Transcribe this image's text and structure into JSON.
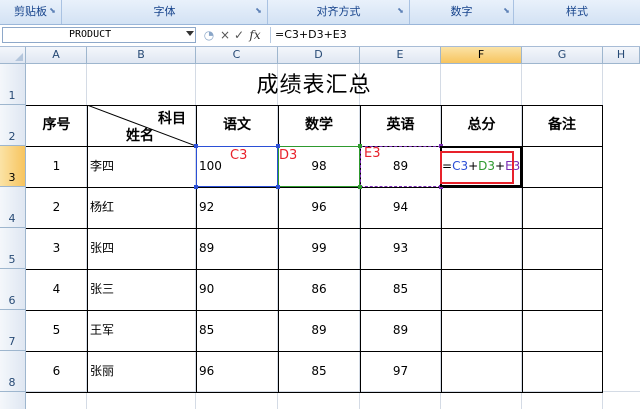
{
  "ribbon": {
    "groups": [
      {
        "label": "剪贴板"
      },
      {
        "label": "字体"
      },
      {
        "label": "对齐方式"
      },
      {
        "label": "数字"
      },
      {
        "label": "样式"
      }
    ]
  },
  "formula_bar": {
    "name_box": "PRODUCT",
    "cancel_symbol": "×",
    "enter_symbol": "✓",
    "fx_label": "fx",
    "formula": "=C3+D3+E3"
  },
  "columns": [
    "A",
    "B",
    "C",
    "D",
    "E",
    "F",
    "G",
    "H"
  ],
  "rows": [
    "1",
    "2",
    "3",
    "4",
    "5",
    "6",
    "7",
    "8"
  ],
  "sheet": {
    "title": "成绩表汇总",
    "headers": {
      "seq": "序号",
      "subject": "科目",
      "name": "姓名",
      "chinese": "语文",
      "math": "数学",
      "english": "英语",
      "total": "总分",
      "remark": "备注"
    },
    "records": [
      {
        "seq": "1",
        "name": "李四",
        "chinese": "100",
        "math": "98",
        "english": "89"
      },
      {
        "seq": "2",
        "name": "杨红",
        "chinese": "92",
        "math": "96",
        "english": "94"
      },
      {
        "seq": "3",
        "name": "张四",
        "chinese": "89",
        "math": "99",
        "english": "93"
      },
      {
        "seq": "4",
        "name": "张三",
        "chinese": "90",
        "math": "86",
        "english": "85"
      },
      {
        "seq": "5",
        "name": "王军",
        "chinese": "85",
        "math": "89",
        "english": "89"
      },
      {
        "seq": "6",
        "name": "张丽",
        "chinese": "96",
        "math": "85",
        "english": "97"
      }
    ],
    "editing_cell": {
      "eq": "=",
      "ref1": "C3",
      "plus1": "+",
      "ref2": "D3",
      "plus2": "+",
      "ref3": "E3"
    },
    "annotations": {
      "c3": "C3",
      "d3": "D3",
      "e3": "E3"
    }
  },
  "colors": {
    "ref_c3": "#2b4fd6",
    "ref_d3": "#2e9a2e",
    "ref_e3": "#7a2bb4",
    "highlight": "#e8222b"
  }
}
